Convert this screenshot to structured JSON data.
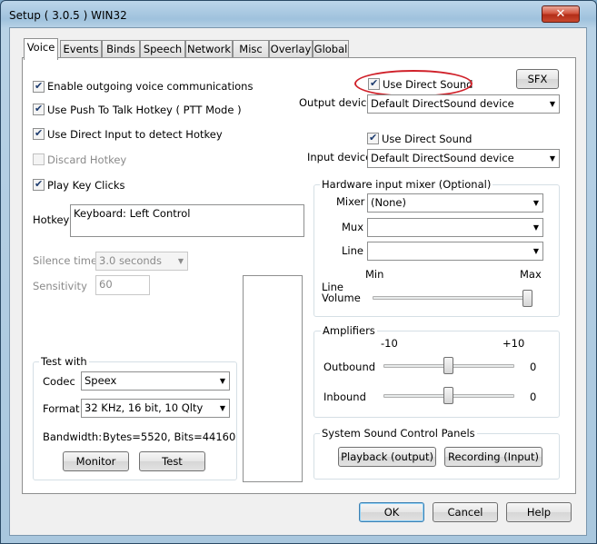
{
  "window": {
    "title": "Setup ( 3.0.5 ) WIN32",
    "close_glyph": "✕"
  },
  "tabs": [
    "Voice",
    "Events",
    "Binds",
    "Speech",
    "Network",
    "Misc",
    "Overlay",
    "Global"
  ],
  "left": {
    "enable_voice": "Enable outgoing voice communications",
    "ptt": "Use Push To Talk Hotkey ( PTT Mode )",
    "direct_input": "Use Direct Input to detect Hotkey",
    "discard": "Discard Hotkey",
    "key_clicks": "Play Key Clicks",
    "hotkey_label": "Hotkey",
    "hotkey_value": "Keyboard: Left Control",
    "silence_label": "Silence time",
    "silence_value": "3.0 seconds",
    "sensitivity_label": "Sensitivity",
    "sensitivity_value": "60"
  },
  "test": {
    "title": "Test with",
    "codec_label": "Codec",
    "codec_value": "Speex",
    "format_label": "Format",
    "format_value": "32 KHz, 16 bit, 10 Qlty",
    "bandwidth_label": "Bandwidth:",
    "bandwidth_value": "Bytes=5520, Bits=44160",
    "monitor": "Monitor",
    "test": "Test"
  },
  "output": {
    "use_direct_sound": "Use Direct Sound",
    "sfx": "SFX",
    "device_label": "Output device",
    "device_value": "Default DirectSound device"
  },
  "input": {
    "use_direct_sound": "Use Direct Sound",
    "device_label": "Input device",
    "device_value": "Default DirectSound device"
  },
  "mixer": {
    "title": "Hardware input mixer (Optional)",
    "mixer_label": "Mixer",
    "mixer_value": "(None)",
    "mux_label": "Mux",
    "line_label": "Line",
    "min": "Min",
    "max": "Max",
    "line_volume_1": "Line",
    "line_volume_2": "Volume",
    "line_volume_level": 1.0
  },
  "amplifiers": {
    "title": "Amplifiers",
    "min": "-10",
    "max": "+10",
    "outbound_label": "Outbound",
    "outbound_value": "0",
    "inbound_label": "Inbound",
    "inbound_value": "0"
  },
  "sound_panels": {
    "title": "System Sound Control Panels",
    "playback": "Playback (output)",
    "recording": "Recording (Input)"
  },
  "footer": {
    "ok": "OK",
    "cancel": "Cancel",
    "help": "Help"
  },
  "colors": {
    "highlight_oval": "#d0212a"
  }
}
